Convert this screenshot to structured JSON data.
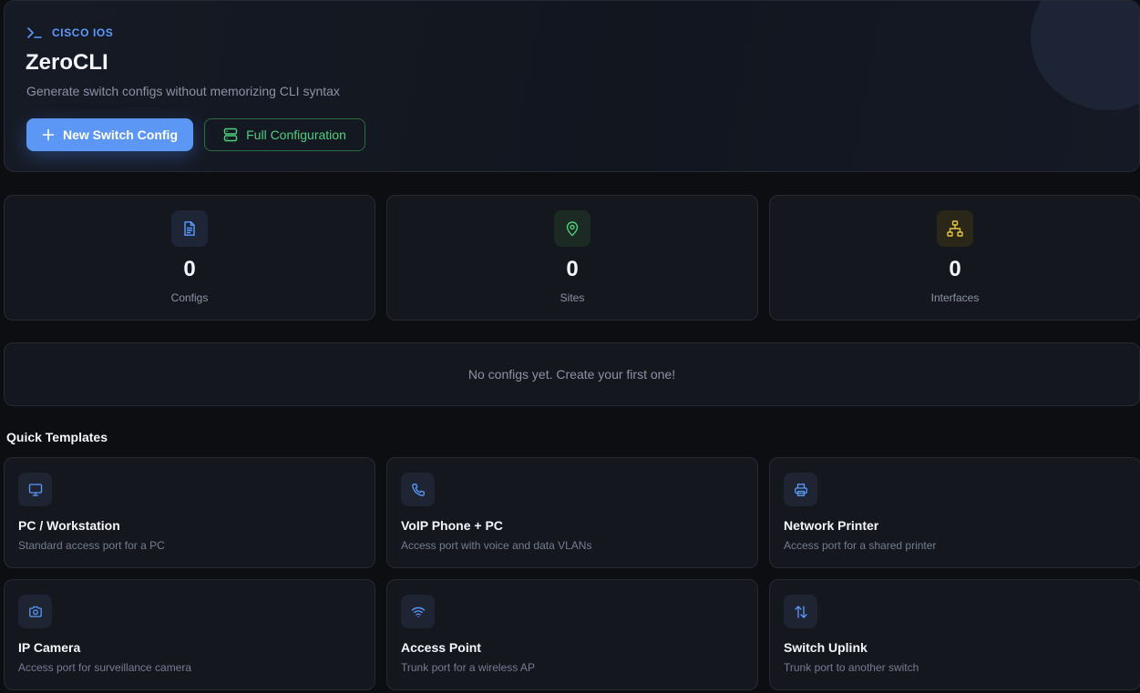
{
  "hero": {
    "eyebrow": "CISCO IOS",
    "title": "ZeroCLI",
    "subtitle": "Generate switch configs without memorizing CLI syntax",
    "primary_button": "New Switch Config",
    "secondary_button": "Full Configuration"
  },
  "stats": [
    {
      "value": "0",
      "label": "Configs",
      "icon": "document-icon",
      "color": "#5b9bff"
    },
    {
      "value": "0",
      "label": "Sites",
      "icon": "map-pin-icon",
      "color": "#4fcf7c"
    },
    {
      "value": "0",
      "label": "Interfaces",
      "icon": "network-icon",
      "color": "#e8c547"
    }
  ],
  "empty_state": "No configs yet. Create your first one!",
  "templates_section": {
    "title": "Quick Templates",
    "items": [
      {
        "title": "PC / Workstation",
        "description": "Standard access port for a PC",
        "icon": "monitor-icon"
      },
      {
        "title": "VoIP Phone + PC",
        "description": "Access port with voice and data VLANs",
        "icon": "phone-icon"
      },
      {
        "title": "Network Printer",
        "description": "Access port for a shared printer",
        "icon": "printer-icon"
      },
      {
        "title": "IP Camera",
        "description": "Access port for surveillance camera",
        "icon": "camera-icon"
      },
      {
        "title": "Access Point",
        "description": "Trunk port for a wireless AP",
        "icon": "wifi-icon"
      },
      {
        "title": "Switch Uplink",
        "description": "Trunk port to another switch",
        "icon": "arrows-up-down-icon"
      }
    ]
  },
  "colors": {
    "accent": "#5c97f5",
    "success": "#4fcf7c",
    "warning": "#e8c547",
    "background": "#0d0e12",
    "card": "#15171e"
  }
}
